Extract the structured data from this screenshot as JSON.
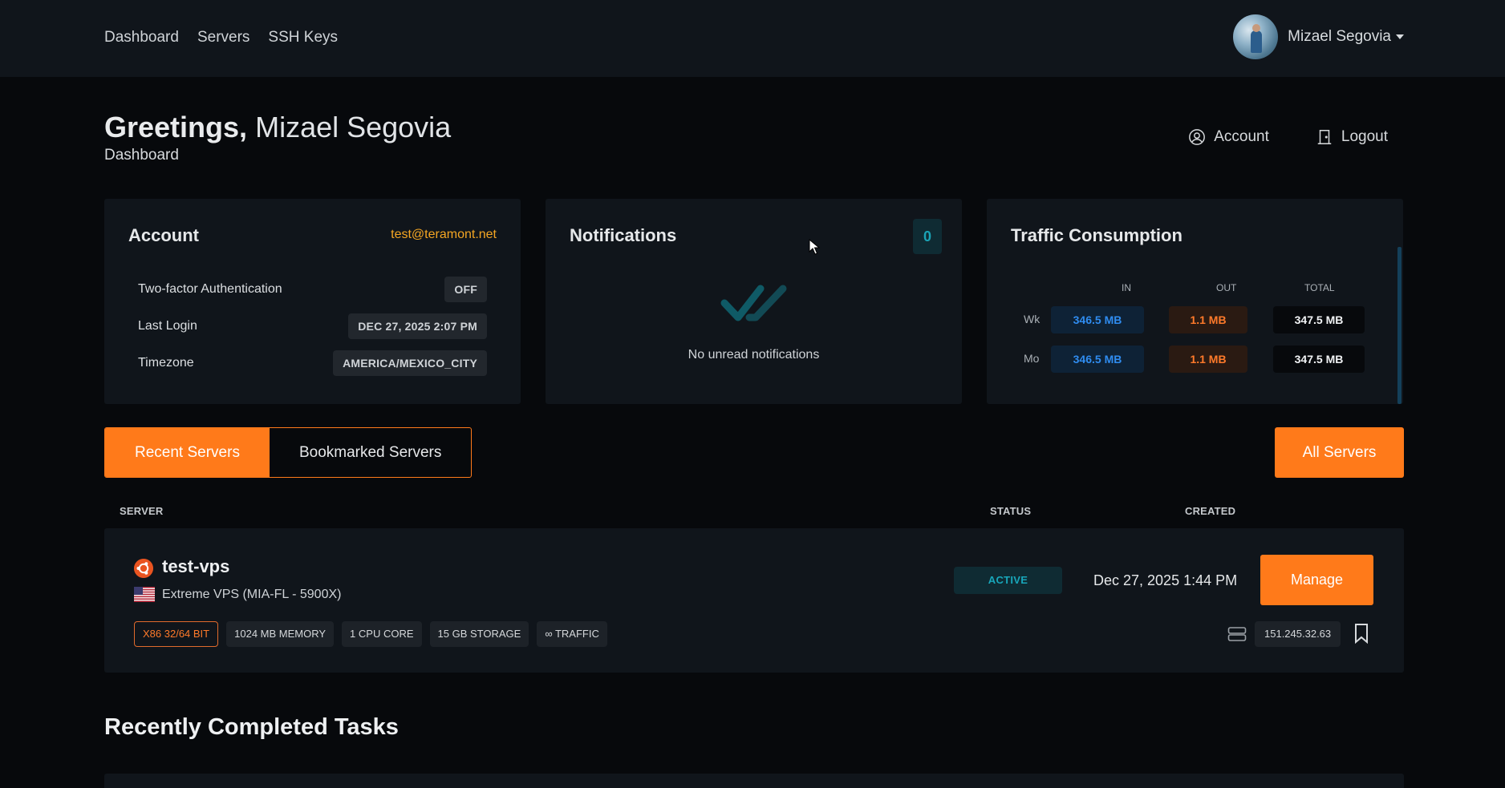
{
  "nav": {
    "links": [
      "Dashboard",
      "Servers",
      "SSH Keys"
    ],
    "user_name": "Mizael Segovia"
  },
  "header": {
    "greeting_bold": "Greetings,",
    "greeting_name": "Mizael Segovia",
    "subtitle": "Dashboard",
    "account_label": "Account",
    "logout_label": "Logout"
  },
  "account_card": {
    "title": "Account",
    "email": "test@teramont.net",
    "rows": [
      {
        "label": "Two-factor Authentication",
        "value": "OFF"
      },
      {
        "label": "Last Login",
        "value": "DEC 27, 2025 2:07 PM"
      },
      {
        "label": "Timezone",
        "value": "AMERICA/MEXICO_CITY"
      }
    ]
  },
  "notifications_card": {
    "title": "Notifications",
    "count": "0",
    "empty_text": "No unread notifications",
    "icon": "double-check-icon"
  },
  "traffic_card": {
    "title": "Traffic Consumption",
    "columns": [
      "IN",
      "OUT",
      "TOTAL"
    ],
    "rows": [
      {
        "label": "Wk",
        "in": "346.5 MB",
        "out": "1.1 MB",
        "total": "347.5 MB"
      },
      {
        "label": "Mo",
        "in": "346.5 MB",
        "out": "1.1 MB",
        "total": "347.5 MB"
      }
    ]
  },
  "server_tabs": {
    "tabs": [
      "Recent Servers",
      "Bookmarked Servers"
    ],
    "active": "Recent Servers",
    "all_servers_label": "All Servers"
  },
  "server_table": {
    "headers": {
      "server": "SERVER",
      "status": "STATUS",
      "created": "CREATED"
    },
    "rows": [
      {
        "name": "test-vps",
        "os_icon": "ubuntu-icon",
        "flag": "us-flag-icon",
        "plan": "Extreme VPS (MIA-FL - 5900X)",
        "specs": [
          "X86 32/64 BIT",
          "1024 MB MEMORY",
          "1 CPU CORE",
          "15 GB STORAGE",
          "∞ TRAFFIC"
        ],
        "status": "ACTIVE",
        "created": "Dec 27, 2025 1:44 PM",
        "manage_label": "Manage",
        "ip": "151.245.32.63"
      }
    ]
  },
  "tasks": {
    "title": "Recently Completed Tasks"
  },
  "colors": {
    "accent": "#ff7a1a",
    "email": "#f5a623",
    "status_active": "#18a6ba",
    "traffic_in": "#2f8cf0",
    "traffic_out": "#ff7a2a"
  }
}
